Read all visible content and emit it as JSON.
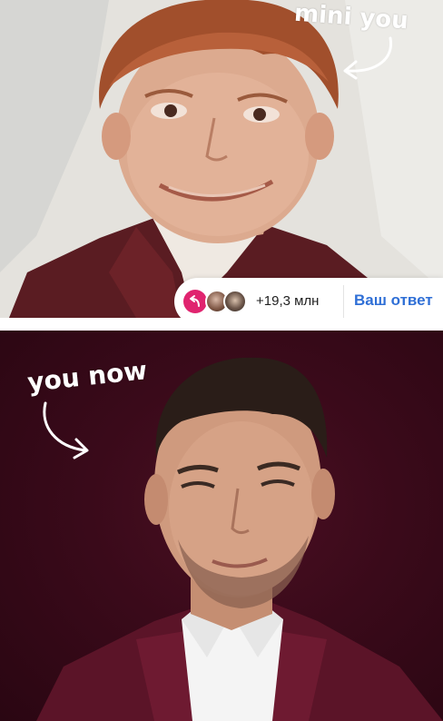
{
  "annotations": {
    "top_text": "mini you",
    "bottom_text": "you now"
  },
  "reply_bar": {
    "reply_icon": "reply-arrow-icon",
    "count": "+19,3 млн",
    "answer_label": "Ваш ответ"
  },
  "colors": {
    "reply_accent": "#e0246f",
    "answer_blue": "#2f6fd6",
    "bottom_background": "#3a0a1a"
  }
}
